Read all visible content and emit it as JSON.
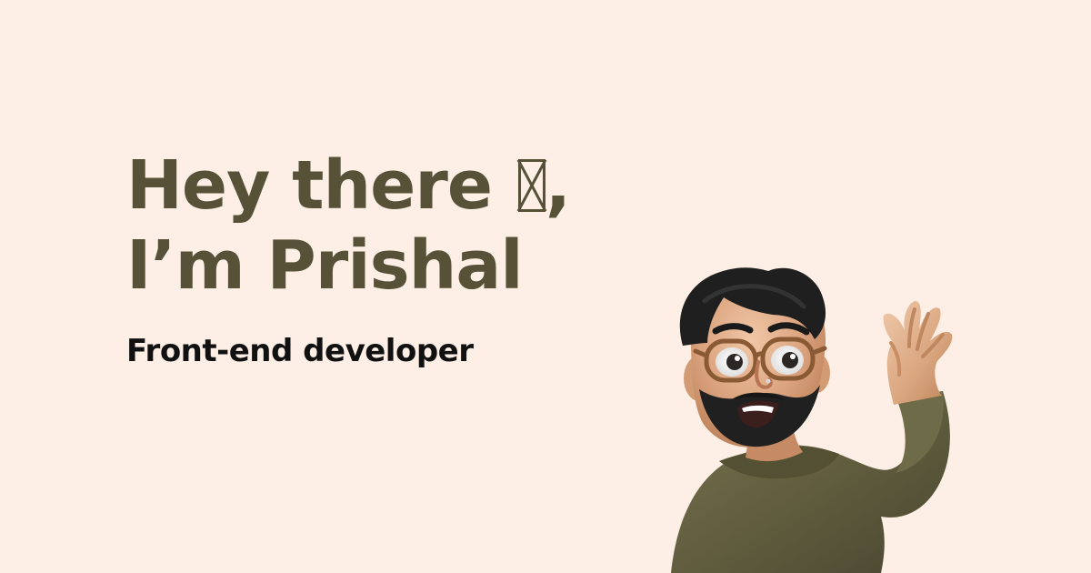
{
  "hero": {
    "greeting": "Hey there ",
    "comma": ",",
    "name_line": "I’m Prishal",
    "role": "Front-end developer"
  },
  "icons": {
    "greeting_glyph": "missing-glyph-icon",
    "avatar": "waving-avatar-icon"
  },
  "colors": {
    "background": "#fdefe5",
    "headline": "#575138",
    "subtitle": "#111111",
    "sweater": "#5d5a3b",
    "skin": "#d9a57e",
    "hair": "#1f1f1f"
  }
}
